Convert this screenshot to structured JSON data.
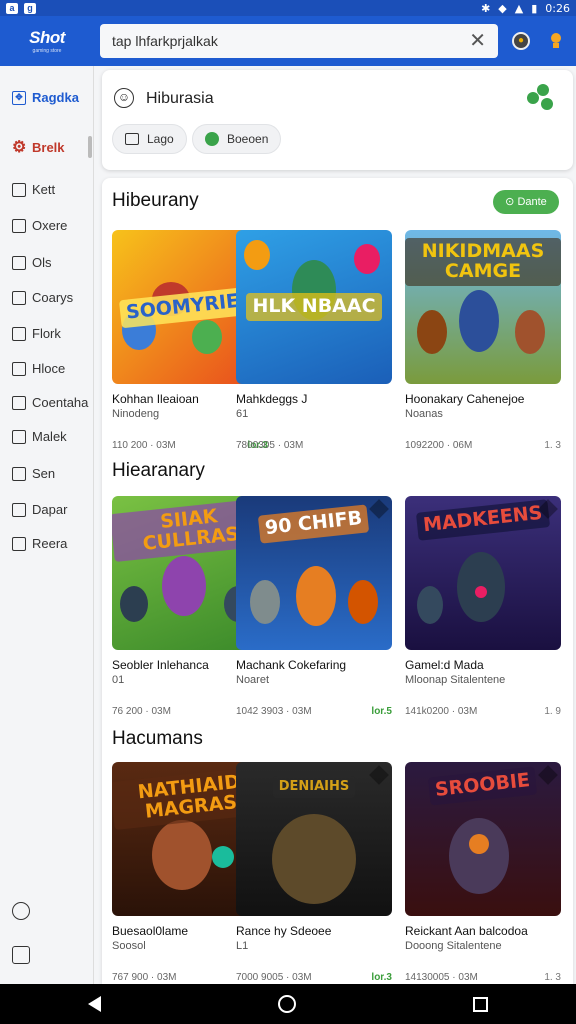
{
  "status_bar": {
    "time": "0:26",
    "left_icons": [
      "a",
      "g"
    ]
  },
  "header": {
    "logo_text": "Shot",
    "logo_sub": "gaming store",
    "search_value": "tap lhfarkprjalkak",
    "search_clear": "✕"
  },
  "sidebar": {
    "items": [
      {
        "label": "Ragdka",
        "icon": "puzzle-icon"
      },
      {
        "label": "Brelk",
        "icon": "settings-gear-icon"
      },
      {
        "label": "Kett",
        "icon": "document-icon"
      },
      {
        "label": "Oxere",
        "icon": "library-icon"
      },
      {
        "label": "Ols",
        "icon": "folder-icon"
      },
      {
        "label": "Coarys",
        "icon": "gallery-icon"
      },
      {
        "label": "Flork",
        "icon": "book-icon"
      },
      {
        "label": "Hloce",
        "icon": "map-icon"
      },
      {
        "label": "Coentaha",
        "icon": "calendar-icon"
      },
      {
        "label": "Malek",
        "icon": "inbox-icon"
      },
      {
        "label": "Sen",
        "icon": "lock-icon"
      },
      {
        "label": "Dapar",
        "icon": "check-box-icon"
      },
      {
        "label": "Reera",
        "icon": "chart-icon"
      }
    ]
  },
  "hub": {
    "title": "Hiburasia",
    "chips": [
      {
        "label": "Lago",
        "icon": "bag-icon"
      },
      {
        "label": "Boeoen",
        "icon": "leaf-icon"
      }
    ]
  },
  "sections": [
    {
      "title": "Hibeurany",
      "action": "⊙ Dante",
      "games": [
        {
          "name": "Kohhan Ileaioan",
          "dev": "Ninodeng",
          "size": "110 200 · 03M",
          "version": "lor.3",
          "art_text": "SOOMYRIEK",
          "colors": [
            "#f7a21b",
            "#e8491d"
          ]
        },
        {
          "name": "Mahkdeggs J",
          "dev": "61",
          "size": "7800305 · 03M",
          "version": "",
          "art_text": "HLK NBAAC",
          "colors": [
            "#2fa0e6",
            "#f1c40f"
          ]
        },
        {
          "name": "Hoonakary Cahenejoe",
          "dev": "Noanas",
          "size": "1092200 · 06M",
          "version": "1. 3",
          "art_text": "NIKIDMAAS CAMGE",
          "colors": [
            "#6fb8e8",
            "#7a9b3c"
          ]
        }
      ]
    },
    {
      "title": "Hiearanary",
      "action": "",
      "games": [
        {
          "name": "Seobler Inlehanca",
          "dev": "01",
          "size": "76 200 · 03M",
          "version": "",
          "art_text": "SIIAK CULLRAS",
          "colors": [
            "#7ac143",
            "#8e44ad"
          ]
        },
        {
          "name": "Machank Cokefaring",
          "dev": "Noaret",
          "size": "1042 3903 · 03M",
          "version": "lor.5",
          "art_text": "90 CHIFB",
          "colors": [
            "#1a3a7a",
            "#e67e22"
          ]
        },
        {
          "name": "Gamel:d Mada",
          "dev": "Mloonap Sitalentene",
          "size": "141k0200 · 03M",
          "version": "1. 9",
          "art_text": "MADKEENS",
          "colors": [
            "#3b2f7a",
            "#c0392b"
          ]
        }
      ]
    },
    {
      "title": "Hacumans",
      "action": "",
      "games": [
        {
          "name": "Buesaol0lame",
          "dev": "Soosol",
          "size": "767 900 · 03M",
          "version": "",
          "art_text": "NATHIAID MAGRAS",
          "colors": [
            "#5a2a12",
            "#f39c12"
          ]
        },
        {
          "name": "Rance hy Sdeoee",
          "dev": "L1",
          "size": "7000 9005 · 03M",
          "version": "lor.3",
          "art_text": "DENIAIHS",
          "colors": [
            "#1a1a1a",
            "#d4a017"
          ]
        },
        {
          "name": "Reickant Aan balcodoa",
          "dev": "Dooong Sitalentene",
          "size": "14130005 · 03M",
          "version": "1. 3",
          "art_text": "SROOBIE",
          "colors": [
            "#2b1a40",
            "#e74c3c"
          ]
        }
      ]
    }
  ],
  "nav": {
    "back": "back",
    "home": "home",
    "recent": "recent"
  }
}
